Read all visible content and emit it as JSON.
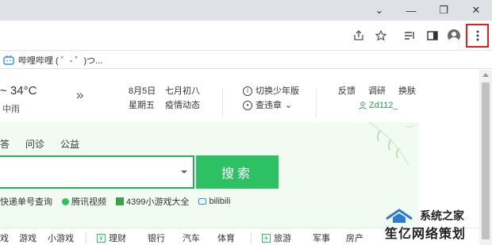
{
  "window": {
    "controls": [
      "⌄",
      "—",
      "❐",
      "✕"
    ]
  },
  "toolbar": {
    "icons": [
      "share-icon",
      "star-icon",
      "reading-list-icon",
      "sidebar-icon",
      "profile-icon",
      "menu-icon"
    ]
  },
  "bookmarks": {
    "item_label": "哔哩哔哩 ( ゜- ゜)つ..."
  },
  "weather": {
    "temp": "~ 34°C",
    "desc": "中雨"
  },
  "date": {
    "d1": "8月5日",
    "d2": "星期五",
    "l1": "七月初八",
    "l2": "疫情动态"
  },
  "edu": {
    "switch": "切换少年版",
    "check": "查违章",
    "check_caret": "⌄"
  },
  "header_links": [
    "反馈",
    "调研",
    "换肤"
  ],
  "user": {
    "name": "Zd112_"
  },
  "search": {
    "tabs": [
      "答",
      "问诊",
      "公益"
    ],
    "button": "搜索"
  },
  "quick": {
    "q1": "快递单号查询",
    "q2": "腾讯视频",
    "q3": "4399小游戏大全",
    "q4": "bilibili"
  },
  "categories": {
    "c1": "戏",
    "c2": "游戏",
    "c3": "小游戏",
    "c4": "理财",
    "c5": "银行",
    "c6": "汽车",
    "c7": "体育",
    "c8": "旅游",
    "c9": "军事",
    "c10": "房产"
  },
  "watermark": {
    "line1": "系统之家",
    "line2": "笙亿网络策划"
  }
}
